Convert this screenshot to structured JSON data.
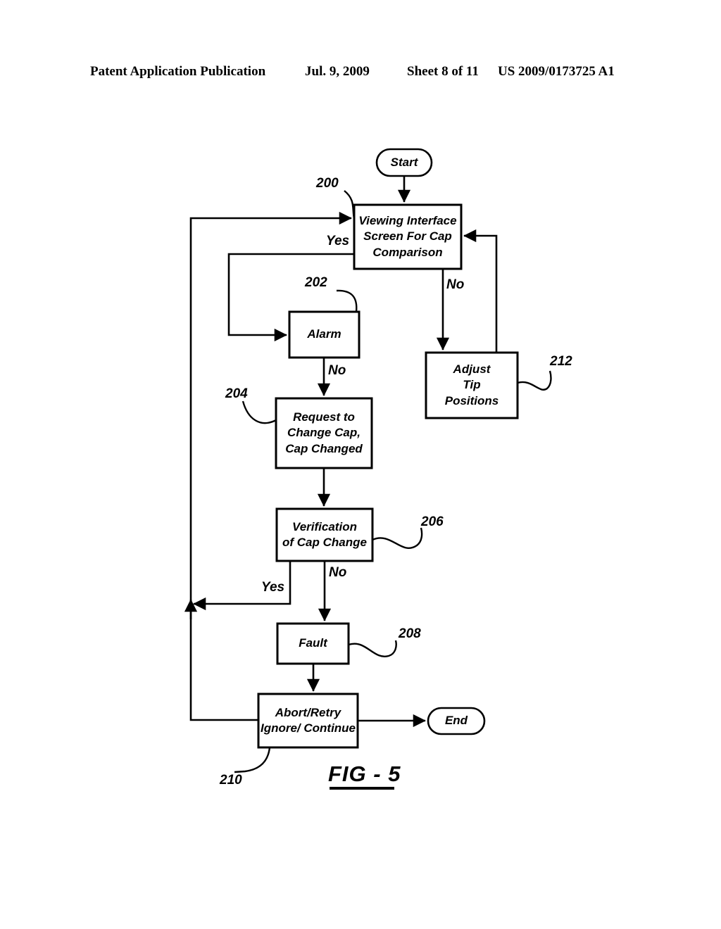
{
  "header": {
    "title": "Patent Application Publication",
    "date": "Jul. 9, 2009",
    "sheet": "Sheet 8 of 11",
    "publication_number": "US 2009/0173725 A1"
  },
  "figure": {
    "caption": "FIG - 5",
    "type": "flowchart"
  },
  "nodes": {
    "start": {
      "label": "Start",
      "shape": "terminator"
    },
    "viewing": {
      "line1": "Viewing Interface",
      "line2": "Screen For Cap",
      "line3": "Comparison",
      "shape": "process",
      "ref": "200"
    },
    "alarm": {
      "label": "Alarm",
      "shape": "process",
      "ref": "202"
    },
    "request": {
      "line1": "Request to",
      "line2": "Change Cap,",
      "line3": "Cap Changed",
      "shape": "process",
      "ref": "204"
    },
    "verification": {
      "line1": "Verification",
      "line2": "of Cap Change",
      "shape": "process",
      "ref": "206"
    },
    "fault": {
      "label": "Fault",
      "shape": "process",
      "ref": "208"
    },
    "abort": {
      "line1": "Abort/Retry",
      "line2": "Ignore/ Continue",
      "shape": "process",
      "ref": "210"
    },
    "adjust": {
      "line1": "Adjust",
      "line2": "Tip",
      "line3": "Positions",
      "shape": "process",
      "ref": "212"
    },
    "end": {
      "label": "End",
      "shape": "terminator"
    }
  },
  "edge_labels": {
    "viewing_yes": "Yes",
    "viewing_no": "No",
    "alarm_no": "No",
    "verification_yes": "Yes",
    "verification_no": "No"
  },
  "colors": {
    "ink": "#000000",
    "paper": "#ffffff"
  }
}
